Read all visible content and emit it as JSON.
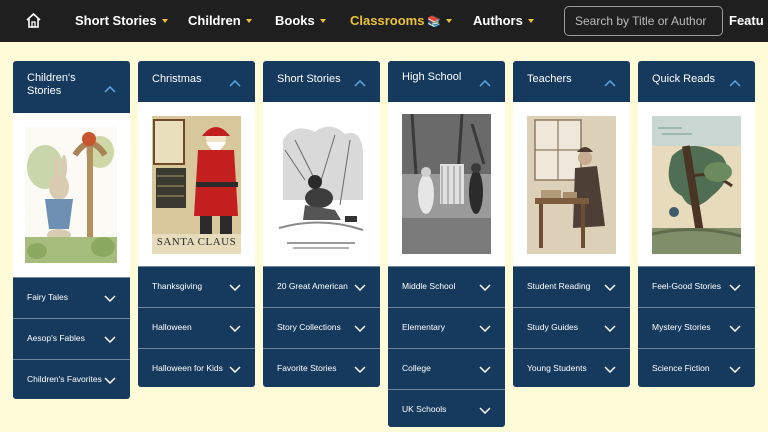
{
  "nav": {
    "items": [
      {
        "label": "Short Stories"
      },
      {
        "label": "Children"
      },
      {
        "label": "Books"
      },
      {
        "label": "Classrooms",
        "emoji": "📚"
      },
      {
        "label": "Authors"
      },
      {
        "label": "Featu"
      }
    ],
    "search_placeholder": "Search by Title or Author",
    "colors": {
      "bar": "#1f1f1f",
      "accent": "#ecc334",
      "panel": "#163a5e",
      "page": "#fefbd8"
    }
  },
  "columns": [
    {
      "title": "Children's Stories",
      "image_caption": "",
      "items": [
        "Fairy Tales",
        "Aesop's Fables",
        "Children's Favorites"
      ]
    },
    {
      "title": "Christmas",
      "image_caption": "SANTA CLAUS",
      "items": [
        "Thanksgiving",
        "Halloween",
        "Halloween for Kids"
      ]
    },
    {
      "title": "Short Stories",
      "image_caption": "",
      "items": [
        "20 Great American",
        "Story Collections",
        "Favorite Stories"
      ]
    },
    {
      "title": "High School",
      "image_caption": "",
      "items": [
        "Middle School",
        "Elementary",
        "College",
        "UK Schools"
      ]
    },
    {
      "title": "Teachers",
      "image_caption": "",
      "items": [
        "Student Reading",
        "Study Guides",
        "Young Students"
      ]
    },
    {
      "title": "Quick Reads",
      "image_caption": "",
      "items": [
        "Feel-Good Stories",
        "Mystery Stories",
        "Science Fiction"
      ]
    }
  ]
}
